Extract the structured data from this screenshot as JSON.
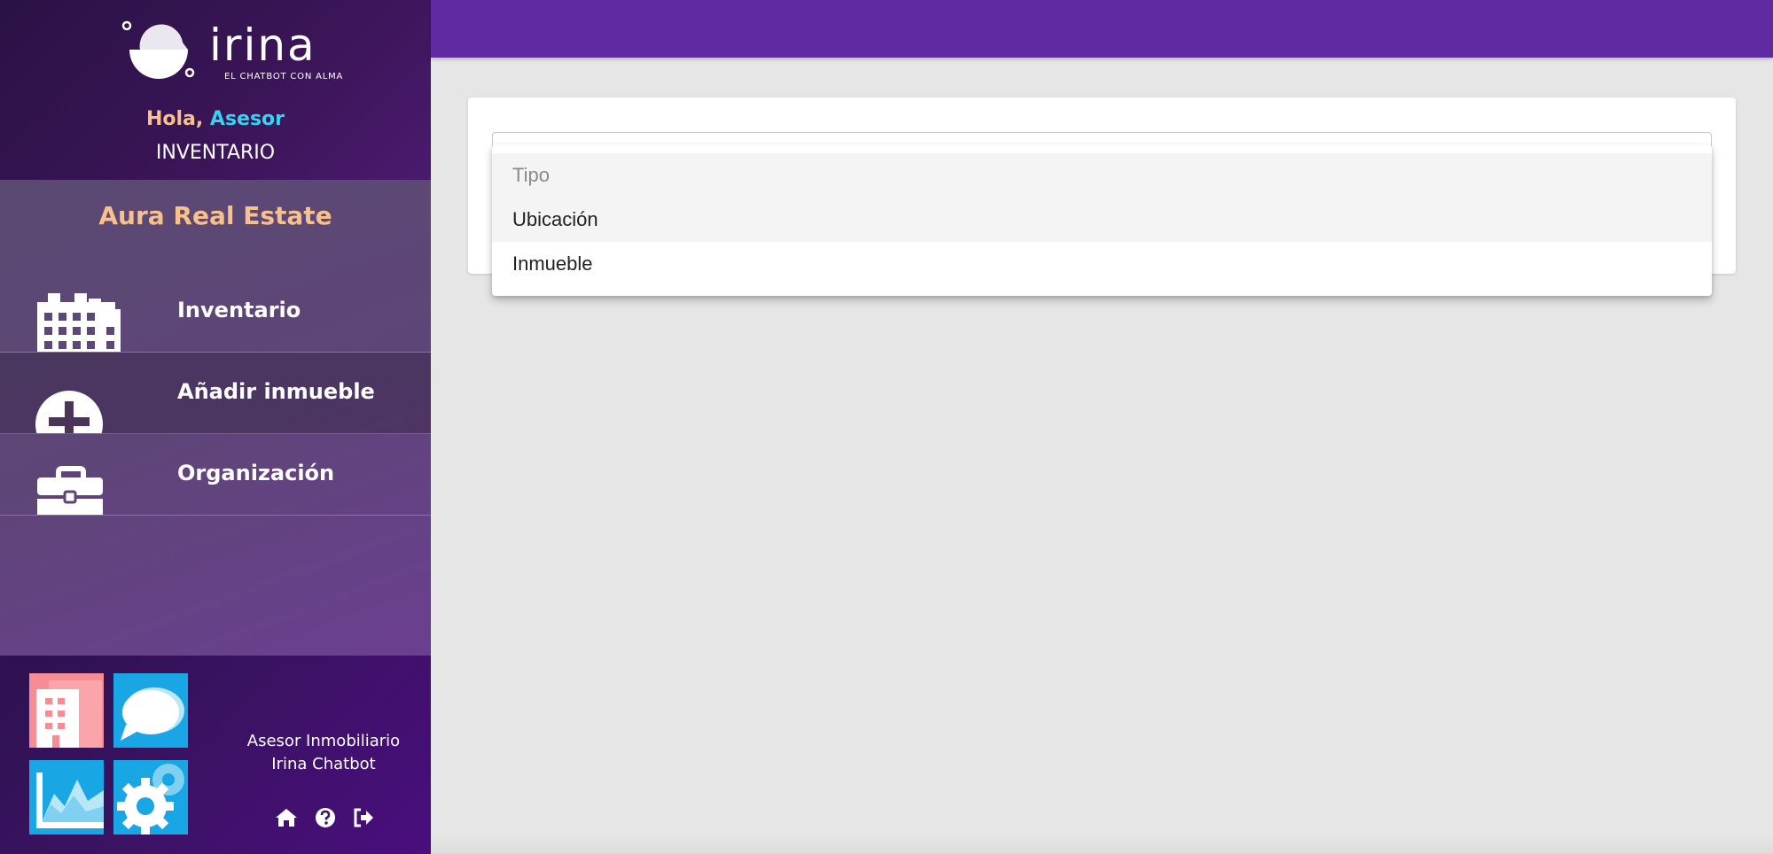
{
  "brand": {
    "wordmark": "irina",
    "tagline": "EL CHATBOT CON ALMA"
  },
  "greeting": {
    "hello": "Hola,",
    "user": "Asesor"
  },
  "section": "INVENTARIO",
  "organization": "Aura Real Estate",
  "nav": {
    "items": [
      {
        "label": "Inventario",
        "icon": "building-icon"
      },
      {
        "label": "Añadir inmueble",
        "icon": "plus-circle-icon"
      },
      {
        "label": "Organización",
        "icon": "briefcase-icon"
      }
    ]
  },
  "footer": {
    "line1": "Asesor Inmobiliario",
    "line2": "Irina Chatbot",
    "icons": [
      "home-icon",
      "help-icon",
      "logout-icon"
    ]
  },
  "dropdown": {
    "placeholder": "Tipo",
    "options": [
      "Ubicación",
      "Inmueble"
    ]
  },
  "colors": {
    "topbar": "#5f2aa2",
    "accent_orange": "#f7c08d",
    "accent_cyan": "#35d3f0"
  }
}
